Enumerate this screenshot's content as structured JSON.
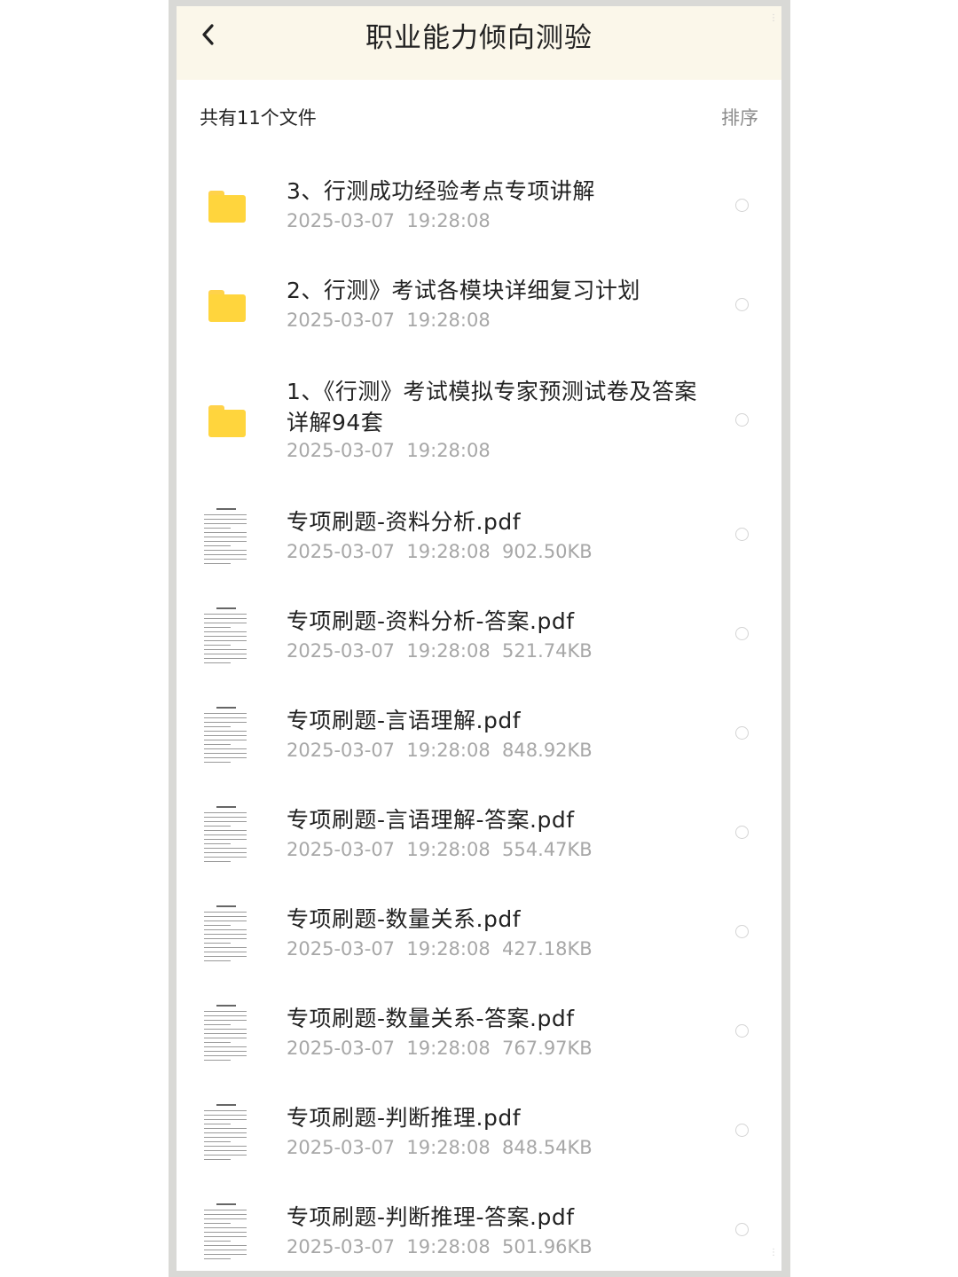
{
  "header": {
    "title": "职业能力倾向测验"
  },
  "toolbar": {
    "count_label": "共有11个文件",
    "sort_label": "排序"
  },
  "files": [
    {
      "type": "folder",
      "name": "3、行测成功经验考点专项讲解",
      "meta": "2025-03-07  19:28:08"
    },
    {
      "type": "folder",
      "name": "2、行测》考试各模块详细复习计划",
      "meta": "2025-03-07  19:28:08"
    },
    {
      "type": "folder",
      "name": "1、《行测》考试模拟专家预测试卷及答案详解94套",
      "meta": "2025-03-07  19:28:08"
    },
    {
      "type": "pdf",
      "name": "专项刷题-资料分析.pdf",
      "meta": "2025-03-07  19:28:08  902.50KB"
    },
    {
      "type": "pdf",
      "name": "专项刷题-资料分析-答案.pdf",
      "meta": "2025-03-07  19:28:08  521.74KB"
    },
    {
      "type": "pdf",
      "name": "专项刷题-言语理解.pdf",
      "meta": "2025-03-07  19:28:08  848.92KB"
    },
    {
      "type": "pdf",
      "name": "专项刷题-言语理解-答案.pdf",
      "meta": "2025-03-07  19:28:08  554.47KB"
    },
    {
      "type": "pdf",
      "name": "专项刷题-数量关系.pdf",
      "meta": "2025-03-07  19:28:08  427.18KB"
    },
    {
      "type": "pdf",
      "name": "专项刷题-数量关系-答案.pdf",
      "meta": "2025-03-07  19:28:08  767.97KB"
    },
    {
      "type": "pdf",
      "name": "专项刷题-判断推理.pdf",
      "meta": "2025-03-07  19:28:08  848.54KB"
    },
    {
      "type": "pdf",
      "name": "专项刷题-判断推理-答案.pdf",
      "meta": "2025-03-07  19:28:08  501.96KB"
    }
  ],
  "icons": {
    "back": "chevron-left-icon",
    "folder": "folder-icon",
    "pdf": "pdf-thumbnail",
    "select": "radio-unchecked-icon"
  },
  "colors": {
    "header_bg": "#fbf7ea",
    "folder": "#ffd53d",
    "meta_text": "#a7a7a7"
  }
}
